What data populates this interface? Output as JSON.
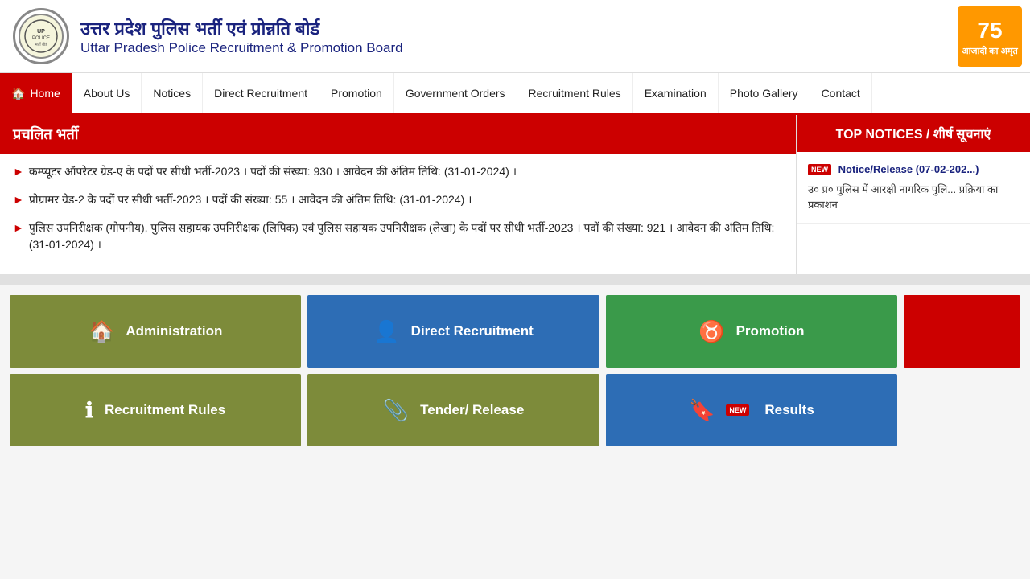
{
  "header": {
    "logo_alt": "UP Police Logo",
    "title_hindi": "उत्तर प्रदेश पुलिस भर्ती एवं प्रोन्नति बोर्ड",
    "title_english": "Uttar Pradesh Police Recruitment & Promotion Board",
    "badge_number": "75",
    "badge_text": "आजादी का अमृत"
  },
  "nav": {
    "items": [
      {
        "id": "home",
        "label": "Home",
        "active": true
      },
      {
        "id": "about",
        "label": "About Us"
      },
      {
        "id": "notices",
        "label": "Notices"
      },
      {
        "id": "direct-recruitment",
        "label": "Direct Recruitment"
      },
      {
        "id": "promotion",
        "label": "Promotion"
      },
      {
        "id": "government-orders",
        "label": "Government Orders"
      },
      {
        "id": "recruitment-rules",
        "label": "Recruitment Rules"
      },
      {
        "id": "examination",
        "label": "Examination"
      },
      {
        "id": "photo-gallery",
        "label": "Photo Gallery"
      },
      {
        "id": "contact",
        "label": "Contact"
      }
    ]
  },
  "left_panel": {
    "header": "प्रचलित भर्ती",
    "notices": [
      {
        "text": "कम्प्यूटर ऑपरेटर ग्रेड-ए के पदों पर सीधी भर्ती-2023 । पदों की संख्या: 930 । आवेदन की अंतिम तिथि: (31-01-2024) ।"
      },
      {
        "text": "प्रोग्रामर ग्रेड-2 के पदों पर सीधी भर्ती-2023 । पदों की संख्या: 55 । आवेदन की अंतिम तिथि: (31-01-2024) ।"
      },
      {
        "text": "पुलिस उपनिरीक्षक (गोपनीय), पुलिस सहायक उपनिरीक्षक (लिपिक) एवं पुलिस सहायक उपनिरीक्षक (लेखा) के पदों पर सीधी भर्ती-2023 । पदों की संख्या: 921 । आवेदन की अंतिम तिथि: (31-01-2024) ।"
      }
    ]
  },
  "right_panel": {
    "header": "TOP NOTICES / शीर्ष सूचनाएं",
    "notices": [
      {
        "is_new": true,
        "title": "Notice/Release (07-02-202...)",
        "text": "उ० प्र० पुलिस में आरक्षी नागरिक पुलि... प्रक्रिया का प्रकाशन"
      }
    ]
  },
  "bottom_cards": {
    "row1": [
      {
        "id": "administration",
        "label": "Administration",
        "icon": "🏠",
        "color": "olive"
      },
      {
        "id": "direct-recruitment",
        "label": "Direct Recruitment",
        "icon": "👤",
        "color": "blue"
      },
      {
        "id": "promotion",
        "label": "Promotion",
        "icon": "♉",
        "color": "green"
      },
      {
        "id": "extra",
        "label": "",
        "color": "red"
      }
    ],
    "row2": [
      {
        "id": "recruitment-rules",
        "label": "Recruitment Rules",
        "icon": "ℹ",
        "color": "olive"
      },
      {
        "id": "tender",
        "label": "Tender/ Release",
        "icon": "📎",
        "color": "olive"
      },
      {
        "id": "results",
        "label": "Results",
        "icon": "🔖",
        "is_new": true,
        "color": "blue"
      }
    ]
  }
}
